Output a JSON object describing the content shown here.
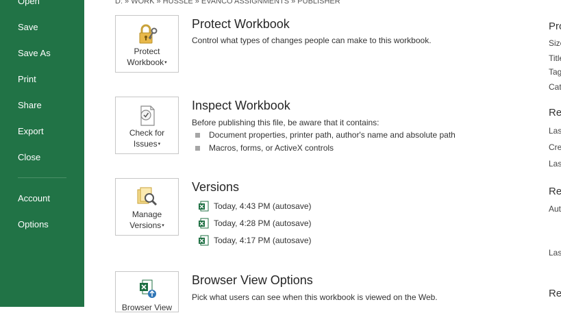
{
  "sidebar": {
    "items": [
      {
        "label": "Open"
      },
      {
        "label": "Save"
      },
      {
        "label": "Save As"
      },
      {
        "label": "Print"
      },
      {
        "label": "Share"
      },
      {
        "label": "Export"
      },
      {
        "label": "Close"
      },
      {
        "label": "Account"
      },
      {
        "label": "Options"
      }
    ]
  },
  "breadcrumb": "D: » WORK » HUSSLE » EVANCO ASSIGNMENTS » PUBLISHER",
  "protect": {
    "tile_label_1": "Protect",
    "tile_label_2": "Workbook",
    "title": "Protect Workbook",
    "desc": "Control what types of changes people can make to this workbook."
  },
  "inspect": {
    "tile_label_1": "Check for",
    "tile_label_2": "Issues",
    "title": "Inspect Workbook",
    "desc": "Before publishing this file, be aware that it contains:",
    "bullets": [
      "Document properties, printer path, author's name and absolute path",
      "Macros, forms, or ActiveX controls"
    ]
  },
  "versions": {
    "tile_label_1": "Manage",
    "tile_label_2": "Versions",
    "title": "Versions",
    "items": [
      "Today, 4:43 PM (autosave)",
      "Today, 4:28 PM (autosave)",
      "Today, 4:17 PM (autosave)"
    ]
  },
  "browser": {
    "tile_label_1": "Browser View",
    "title": "Browser View Options",
    "desc": "Pick what users can see when this workbook is viewed on the Web."
  },
  "properties_clipped": {
    "head1": "Pro",
    "rows1": [
      "Size",
      "Title",
      "Tag",
      "Cat"
    ],
    "head2": "Re",
    "rows2": [
      "Las",
      "Cre",
      "Las"
    ],
    "head3": "Re",
    "rows3": [
      "Aut"
    ],
    "row4": "Las",
    "head4": "Re"
  },
  "colors": {
    "sidebar": "#217346",
    "excel_green": "#1d6f42"
  }
}
